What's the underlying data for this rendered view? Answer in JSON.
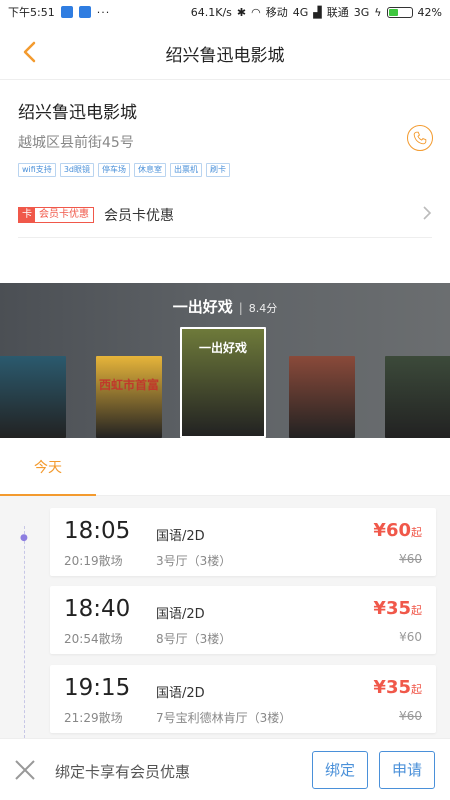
{
  "status_bar": {
    "time": "下午5:51",
    "speed": "64.1K/s",
    "carrier1": "移动",
    "net1": "4G",
    "carrier2": "联通",
    "net2": "3G",
    "battery": "42%",
    "battery_level": 0.42
  },
  "header": {
    "title": "绍兴鲁迅电影城"
  },
  "cinema": {
    "name": "绍兴鲁迅电影城",
    "address": "越城区县前街45号",
    "tags": [
      "wifi支持",
      "3d眼镜",
      "停车场",
      "休息室",
      "出票机",
      "刷卡"
    ]
  },
  "member": {
    "badge_icon": "卡",
    "badge_text": "会员卡优惠",
    "label": "会员卡优惠"
  },
  "banner": {
    "title": "一出好戏",
    "score": "8.4分",
    "posters": [
      {
        "name": "poster-1",
        "color": "#2b5a6e",
        "text": ""
      },
      {
        "name": "poster-2",
        "color": "#e7b53a",
        "text": "西虹市首富"
      },
      {
        "name": "poster-3",
        "color": "#6e7a3a",
        "text": "一出好戏"
      },
      {
        "name": "poster-4",
        "color": "#8a4a3a",
        "text": ""
      },
      {
        "name": "poster-5",
        "color": "#3c4a3a",
        "text": ""
      }
    ]
  },
  "dates": {
    "today": "今天"
  },
  "showtimes": [
    {
      "start": "18:05",
      "end": "20:19散场",
      "lang": "国语/2D",
      "hall": "3号厅（3楼）",
      "price": "¥60",
      "price_suffix": "起",
      "original": "¥60",
      "strike": true
    },
    {
      "start": "18:40",
      "end": "20:54散场",
      "lang": "国语/2D",
      "hall": "8号厅（3楼）",
      "price": "¥35",
      "price_suffix": "起",
      "original": "¥60",
      "strike": false
    },
    {
      "start": "19:15",
      "end": "21:29散场",
      "lang": "国语/2D",
      "hall": "7号宝利德林肯厅（3楼）",
      "price": "¥35",
      "price_suffix": "起",
      "original": "¥60",
      "strike": true
    }
  ],
  "bottom": {
    "text": "绑定卡享有会员优惠",
    "bind_label": "绑定",
    "apply_label": "申请"
  },
  "colors": {
    "accent": "#f39a2e",
    "price": "#f0584a",
    "link": "#4a90d9"
  }
}
